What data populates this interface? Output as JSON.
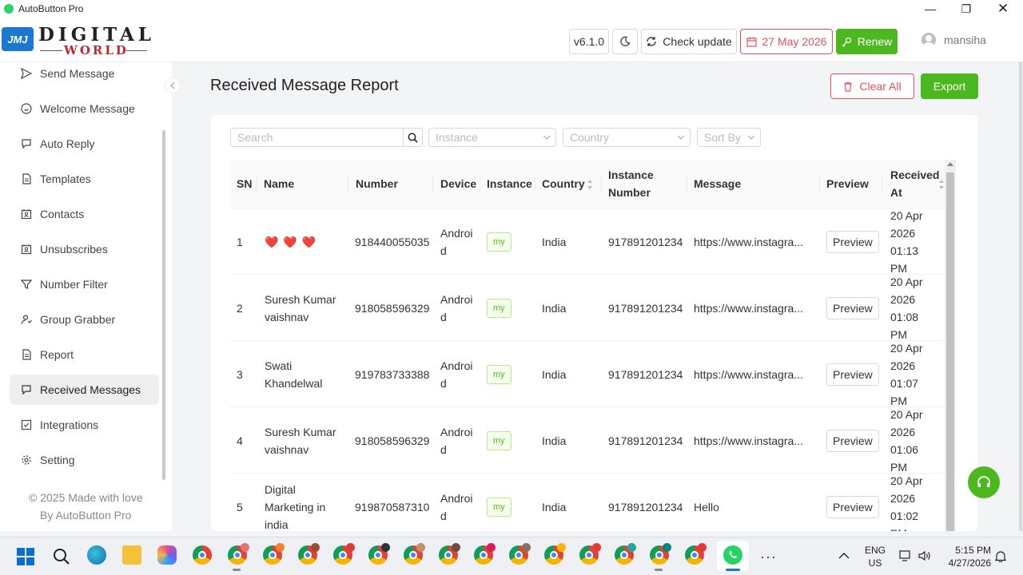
{
  "window": {
    "title": "AutoButton Pro",
    "controls": [
      "minimize",
      "maximize",
      "close"
    ]
  },
  "logo": {
    "badge": "JMJ",
    "line1": "DIGITAL",
    "line2": "WORLD"
  },
  "header": {
    "version": "v6.1.0",
    "check_update": "Check update",
    "expiry_date": "27 May 2026",
    "renew": "Renew",
    "username": "mansiha"
  },
  "sidebar": {
    "items": [
      {
        "label": "Send Message",
        "icon": "send-icon"
      },
      {
        "label": "Welcome Message",
        "icon": "smile-icon"
      },
      {
        "label": "Auto Reply",
        "icon": "chat-icon"
      },
      {
        "label": "Templates",
        "icon": "file-icon"
      },
      {
        "label": "Contacts",
        "icon": "contacts-icon"
      },
      {
        "label": "Unsubscribes",
        "icon": "contacts-icon"
      },
      {
        "label": "Number Filter",
        "icon": "filter-icon"
      },
      {
        "label": "Group Grabber",
        "icon": "group-icon"
      },
      {
        "label": "Report",
        "icon": "file-icon"
      },
      {
        "label": "Received Messages",
        "icon": "chat-icon",
        "active": true
      },
      {
        "label": "Integrations",
        "icon": "check-square-icon"
      },
      {
        "label": "Setting",
        "icon": "gear-icon"
      }
    ],
    "footer_line1": "© 2025 Made with love",
    "footer_line2": "By AutoButton Pro"
  },
  "page": {
    "title": "Received Message Report",
    "clear_all": "Clear All",
    "export": "Export"
  },
  "filters": {
    "search_placeholder": "Search",
    "instance_placeholder": "Instance",
    "country_placeholder": "Country",
    "sort_placeholder": "Sort By"
  },
  "table": {
    "columns": {
      "sn": "SN",
      "name": "Name",
      "number": "Number",
      "device": "Device",
      "instance": "Instance",
      "country": "Country",
      "instance_number_1": "Instance",
      "instance_number_2": "Number",
      "message": "Message",
      "preview": "Preview",
      "received_1": "Received",
      "received_2": "At"
    },
    "rows": [
      {
        "sn": "1",
        "name1": "❤️ ❤️ ❤️",
        "name2": "",
        "name3": "",
        "number": "918440055035",
        "device1": "Androi",
        "device2": "d",
        "instance": "my",
        "country": "India",
        "instance_number": "917891201234",
        "message": "https://www.instagra...",
        "preview": "Preview",
        "r1": "20 Apr",
        "r2": "2026 01:13",
        "r3": "PM"
      },
      {
        "sn": "2",
        "name1": "Suresh Kumar",
        "name2": "vaishnav",
        "name3": "",
        "number": "918058596329",
        "device1": "Androi",
        "device2": "d",
        "instance": "my",
        "country": "India",
        "instance_number": "917891201234",
        "message": "https://www.instagra...",
        "preview": "Preview",
        "r1": "20 Apr",
        "r2": "2026 01:08",
        "r3": "PM"
      },
      {
        "sn": "3",
        "name1": "Swati",
        "name2": "Khandelwal",
        "name3": "",
        "number": "919783733388",
        "device1": "Androi",
        "device2": "d",
        "instance": "my",
        "country": "India",
        "instance_number": "917891201234",
        "message": "https://www.instagra...",
        "preview": "Preview",
        "r1": "20 Apr",
        "r2": "2026 01:07",
        "r3": "PM"
      },
      {
        "sn": "4",
        "name1": "Suresh Kumar",
        "name2": "vaishnav",
        "name3": "",
        "number": "918058596329",
        "device1": "Androi",
        "device2": "d",
        "instance": "my",
        "country": "India",
        "instance_number": "917891201234",
        "message": "https://www.instagra...",
        "preview": "Preview",
        "r1": "20 Apr",
        "r2": "2026 01:06",
        "r3": "PM"
      },
      {
        "sn": "5",
        "name1": "Digital",
        "name2": "Marketing in",
        "name3": "india",
        "number": "919870587310",
        "device1": "Androi",
        "device2": "d",
        "instance": "my",
        "country": "India",
        "instance_number": "917891201234",
        "message": "Hello",
        "preview": "Preview",
        "r1": "20 Apr",
        "r2": "2026 01:02",
        "r3": "PM"
      }
    ]
  },
  "taskbar": {
    "lang1": "ENG",
    "lang2": "US",
    "time": "5:15 PM",
    "date": "4/27/2026"
  },
  "colors": {
    "accent_green": "#4cb81f",
    "danger_red": "#e6505a"
  }
}
